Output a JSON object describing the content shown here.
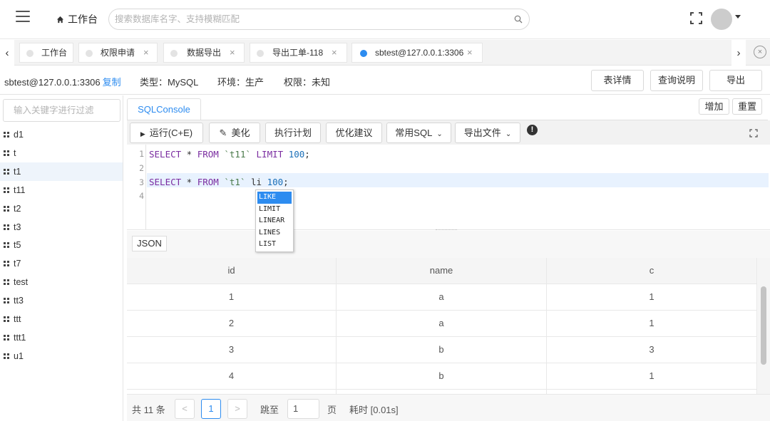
{
  "header": {
    "home_label": "工作台",
    "search_placeholder": "搜索数据库名字、支持模糊匹配"
  },
  "tabs": [
    {
      "label": "工作台"
    },
    {
      "label": "权限申请"
    },
    {
      "label": "数据导出"
    },
    {
      "label": "导出工单-118"
    },
    {
      "label": "sbtest@127.0.0.1:3306",
      "active": true
    }
  ],
  "tab_close": "×",
  "infobar": {
    "connection": "sbtest@127.0.0.1:3306",
    "copy_label": "复制",
    "type": "类型：MySQL",
    "env": "环境：生产",
    "perm": "权限：未知",
    "buttons": {
      "details": "表详情",
      "help": "查询说明",
      "export": "导出"
    }
  },
  "sidebar": {
    "filter_placeholder": "输入关键字进行过滤",
    "tables": [
      "d1",
      "t",
      "t1",
      "t11",
      "t2",
      "t3",
      "t5",
      "t7",
      "test",
      "tt3",
      "ttt",
      "ttt1",
      "u1"
    ],
    "selected": "t1"
  },
  "console": {
    "tab_label": "SQLConsole",
    "add_label": "增加",
    "reset_label": "重置",
    "toolbar": {
      "run": "运行(C+E)",
      "beautify": "美化",
      "plan": "执行计划",
      "optimize": "优化建议",
      "common_sql": "常用SQL",
      "export_file": "导出文件"
    }
  },
  "editor": {
    "line_numbers": [
      "1",
      "2",
      "3",
      "4"
    ],
    "line1": {
      "kw1": "SELECT",
      "star": " * ",
      "kw2": "FROM",
      "tbl": " `t11` ",
      "kw3": "LIMIT",
      "num": " 100",
      "end": ";"
    },
    "line3": {
      "kw1": "SELECT",
      "star": " * ",
      "kw2": "FROM",
      "tbl": " `t1` ",
      "typed": "li",
      "num": " 100",
      "end": ";"
    },
    "autocomplete": [
      "LIKE",
      "LIMIT",
      "LINEAR",
      "LINES",
      "LIST"
    ]
  },
  "results": {
    "json_label": "JSON",
    "columns": [
      "id",
      "name",
      "c"
    ],
    "rows": [
      [
        "1",
        "a",
        "1"
      ],
      [
        "2",
        "a",
        "1"
      ],
      [
        "3",
        "b",
        "3"
      ],
      [
        "4",
        "b",
        "1"
      ]
    ]
  },
  "pager": {
    "total": "共 11 条",
    "prev": "<",
    "current": "1",
    "next": ">",
    "jump_label": "跳至",
    "jump_value": "1",
    "page_label": "页",
    "time": "耗时 [0.01s]"
  }
}
